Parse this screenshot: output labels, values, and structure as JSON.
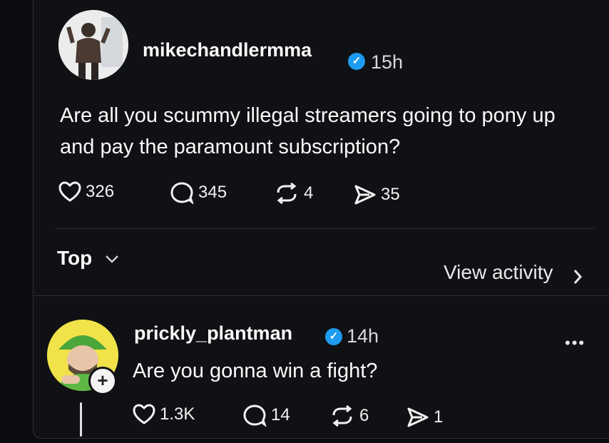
{
  "post": {
    "username": "mikechandlermma",
    "verified": true,
    "time": "15h",
    "text": "Are all you scummy illegal streamers going to pony up and pay the paramount subscription?",
    "stats": {
      "likes": "326",
      "replies": "345",
      "reposts": "4",
      "shares": "35"
    }
  },
  "sort": {
    "label": "Top",
    "view_activity": "View activity"
  },
  "reply": {
    "username": "prickly_plantman",
    "verified": true,
    "time": "14h",
    "text": "Are you gonna win a fight?",
    "stats": {
      "likes": "1.3K",
      "replies": "14",
      "reposts": "6",
      "shares": "1"
    },
    "more": "•••",
    "follow": "+"
  },
  "colors": {
    "background": "#0b0c10",
    "verified": "#1d9bf0",
    "text": "#fafafa"
  },
  "icons": [
    "heart-icon",
    "reply-icon",
    "repost-icon",
    "share-icon",
    "chevron-down-icon",
    "chevron-right-icon",
    "more-icon",
    "verified-icon"
  ]
}
